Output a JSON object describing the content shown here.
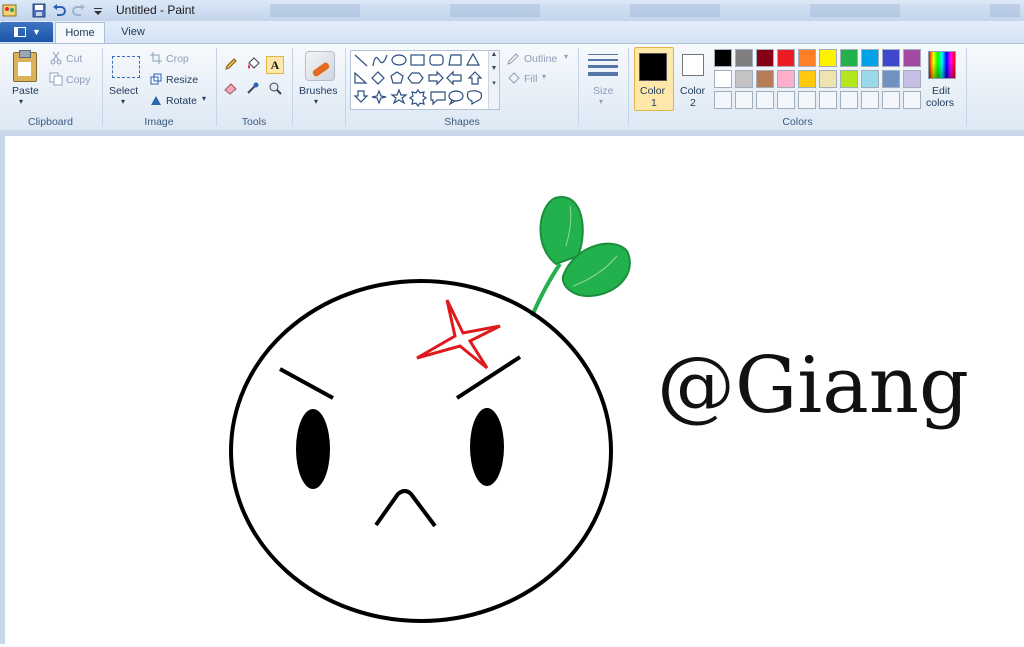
{
  "window": {
    "title": "Untitled - Paint"
  },
  "quick_access": {
    "icons": [
      "paint-app-icon",
      "save-icon",
      "undo-icon",
      "redo-icon",
      "customize-dropdown-icon"
    ]
  },
  "tabs": [
    {
      "label": "Home",
      "active": true
    },
    {
      "label": "View",
      "active": false
    }
  ],
  "ribbon": {
    "clipboard": {
      "group_label": "Clipboard",
      "paste": "Paste",
      "cut": "Cut",
      "copy": "Copy"
    },
    "image": {
      "group_label": "Image",
      "select": "Select",
      "crop": "Crop",
      "resize": "Resize",
      "rotate": "Rotate"
    },
    "tools": {
      "group_label": "Tools",
      "icons": [
        "pencil-icon",
        "fill-icon",
        "text-icon",
        "eraser-icon",
        "color-picker-icon",
        "magnifier-icon"
      ],
      "selected": "text-icon"
    },
    "brushes": {
      "label": "Brushes"
    },
    "shapes": {
      "group_label": "Shapes",
      "outline": "Outline",
      "fill": "Fill"
    },
    "size": {
      "label": "Size"
    },
    "colors": {
      "group_label": "Colors",
      "color1_label": "Color",
      "color1_num": "1",
      "color2_label": "Color",
      "color2_num": "2",
      "color1_value": "#000000",
      "color2_value": "#ffffff",
      "edit_label": "Edit",
      "edit_label2": "colors",
      "palette_row1": [
        "#000000",
        "#7f7f7f",
        "#880015",
        "#ed1c24",
        "#ff7f27",
        "#fff200",
        "#22b14c",
        "#00a2e8",
        "#3f48cc",
        "#a349a4"
      ],
      "palette_row2": [
        "#ffffff",
        "#c3c3c3",
        "#b97a57",
        "#ffaec9",
        "#ffc90e",
        "#efe4b0",
        "#b5e61d",
        "#99d9ea",
        "#7092be",
        "#c8bfe7"
      ]
    }
  },
  "canvas": {
    "text": "@Giang",
    "drawing": "angry face with sprout",
    "colors": {
      "outline": "#000000",
      "anger_mark": "#e0191f",
      "leaf": "#22b14c"
    }
  }
}
